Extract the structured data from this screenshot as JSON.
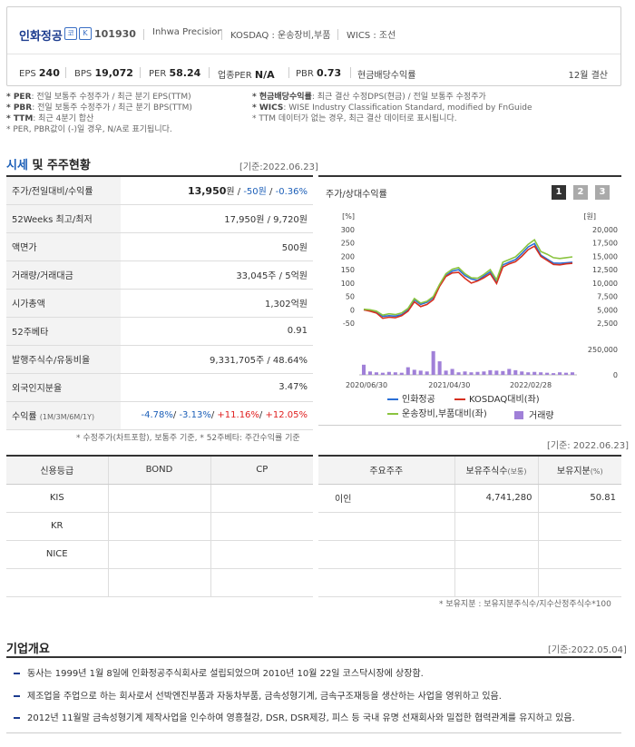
{
  "header": {
    "company_name": "인화정공",
    "icon_a": "코",
    "icon_b": "K",
    "code": "101930",
    "english_name": "Inhwa Precision",
    "market": "KOSDAQ : 운송장비,부품",
    "wics": "WICS : 조선",
    "eps_label": "EPS",
    "eps_value": "240",
    "bps_label": "BPS",
    "bps_value": "19,072",
    "per_label": "PER",
    "per_value": "58.24",
    "sector_per_label": "업종PER",
    "sector_per_value": "N/A",
    "pbr_label": "PBR",
    "pbr_value": "0.73",
    "div_label": "현금배당수익률",
    "fiscal": "12월 결산"
  },
  "notes": {
    "left": [
      {
        "key": "* PER",
        "text": ": 전일 보통주 수정주가 / 최근 분기 EPS(TTM)"
      },
      {
        "key": "* PBR",
        "text": ": 전일 보통주 수정주가 / 최근 분기 BPS(TTM)"
      },
      {
        "key": "* TTM",
        "text": ": 최근 4분기 합산"
      },
      {
        "key": "",
        "text": "* PER, PBR값이 (-)일 경우, N/A로 표기됩니다."
      }
    ],
    "right": [
      {
        "key": "* 현금배당수익률",
        "text": ": 최근 결산 수정DPS(현금) / 전일 보통주 수정주가"
      },
      {
        "key": "* WICS",
        "text": ": WISE Industry Classification Standard, modified by FnGuide"
      },
      {
        "key": "",
        "text": "* TTM 데이터가 없는 경우, 최근 결산 데이터로 표시됩니다."
      }
    ]
  },
  "market_section": {
    "title_a": "시세",
    "title_b": " 및 주주현황",
    "base_date": "[기준:2022.06.23]",
    "rows": [
      {
        "label": "주가/전일대비/수익률",
        "price": "13,950",
        "unit": "원",
        "change": "-50원",
        "rate": "-0.36%"
      },
      {
        "label": "52Weeks 최고/최저",
        "value": "17,950원 / 9,720원"
      },
      {
        "label": "액면가",
        "value": "500원"
      },
      {
        "label": "거래량/거래대금",
        "value": "33,045주 / 5억원"
      },
      {
        "label": "시가총액",
        "value": "1,302억원"
      },
      {
        "label": "52주베타",
        "value": "0.91"
      },
      {
        "label": "발행주식수/유동비율",
        "value": "9,331,705주 / 48.64%"
      },
      {
        "label": "외국인지분율",
        "value": "3.47%"
      },
      {
        "label": "수익률",
        "label_sub": "(1M/3M/6M/1Y)",
        "r1": "-4.78%",
        "r2": "-3.13%",
        "r3": "+11.16%",
        "r4": "+12.05%"
      }
    ],
    "footnote": "* 수정주가(차트포함), 보통주 기준, * 52주베타: 주간수익률 기준"
  },
  "chart_panel": {
    "title": "주가/상대수익률",
    "pages": [
      "1",
      "2",
      "3"
    ],
    "left_unit": "[%]",
    "right_unit": "[원]"
  },
  "chart_data": {
    "type": "line",
    "x_ticks": [
      "2020/06/30",
      "2021/04/30",
      "2022/02/28"
    ],
    "y_left_ticks": [
      "300",
      "250",
      "200",
      "150",
      "100",
      "50",
      "0",
      "-50"
    ],
    "ylim_left": [
      -50,
      300
    ],
    "y_right_ticks": [
      "20,000",
      "17,500",
      "15,000",
      "12,500",
      "10,000",
      "7,500",
      "5,000",
      "2,500"
    ],
    "ylim_right": [
      2500,
      20000
    ],
    "volume_tick": "250,000",
    "volume_zero": "0",
    "x_index": [
      0,
      1,
      2,
      3,
      4,
      5,
      6,
      7,
      8,
      9,
      10,
      11,
      12,
      13,
      14,
      15,
      16,
      17,
      18,
      19,
      20,
      21,
      22,
      23,
      24,
      25,
      26,
      27,
      28,
      29,
      30,
      31,
      32,
      33
    ],
    "series": [
      {
        "name": "인화정공",
        "color": "#2a6fd6",
        "values": [
          0,
          -2,
          -8,
          -25,
          -22,
          -24,
          -18,
          0,
          38,
          20,
          28,
          45,
          92,
          128,
          145,
          150,
          128,
          115,
          110,
          126,
          142,
          105,
          168,
          178,
          188,
          210,
          235,
          248,
          205,
          190,
          175,
          174,
          176,
          178
        ]
      },
      {
        "name": "KOSDAQ대비(좌)",
        "color": "#d6301f",
        "values": [
          0,
          -5,
          -12,
          -32,
          -28,
          -30,
          -22,
          -5,
          30,
          12,
          20,
          38,
          88,
          125,
          138,
          140,
          118,
          100,
          108,
          120,
          135,
          98,
          160,
          172,
          180,
          200,
          225,
          238,
          200,
          185,
          170,
          168,
          172,
          174
        ]
      },
      {
        "name": "운송장비,부품대비(좌)",
        "color": "#8ac43f",
        "values": [
          2,
          0,
          -5,
          -20,
          -15,
          -18,
          -12,
          5,
          42,
          25,
          32,
          50,
          95,
          135,
          152,
          158,
          135,
          120,
          118,
          132,
          150,
          112,
          178,
          188,
          198,
          220,
          245,
          262,
          218,
          208,
          195,
          192,
          195,
          198
        ]
      }
    ],
    "volume": {
      "name": "거래량",
      "color": "#a080d8",
      "values": [
        120,
        40,
        30,
        25,
        35,
        30,
        25,
        90,
        60,
        50,
        40,
        280,
        160,
        50,
        70,
        30,
        40,
        30,
        35,
        40,
        55,
        50,
        45,
        70,
        55,
        40,
        30,
        35,
        30,
        25,
        20,
        30,
        25,
        30
      ]
    }
  },
  "credit_section": {
    "headers": [
      "신용등급",
      "BOND",
      "CP"
    ],
    "rows": [
      [
        "KIS",
        "",
        ""
      ],
      [
        "KR",
        "",
        ""
      ],
      [
        "NICE",
        "",
        ""
      ],
      [
        "",
        "",
        ""
      ]
    ]
  },
  "holders_section": {
    "base_date": "[기준: 2022.06.23]",
    "headers": [
      "주요주주",
      "보유주식수",
      "(보통)",
      "보유지분",
      "(%)"
    ],
    "rows": [
      [
        "이인",
        "4,741,280",
        "50.81"
      ],
      [
        "",
        "",
        ""
      ],
      [
        "",
        "",
        ""
      ],
      [
        "",
        "",
        ""
      ]
    ],
    "footnote": "* 보유지분 : 보유지분주식수/지수산정주식수*100"
  },
  "company_section": {
    "title": "기업개요",
    "base_date": "[기준:2022.05.04]",
    "items": [
      "동사는 1999년 1월 8일에 인화정공주식회사로 설립되었으며 2010년 10월 22일 코스닥시장에 상장함.",
      "제조업을 주업으로 하는 회사로서 선박엔진부품과 자동차부품, 금속성형기계, 금속구조재등을 생산하는 사업을 영위하고 있음.",
      "2012년 11월말 금속성형기계 제작사업을 인수하여 영흥철강, DSR, DSR제강, 피스 등 국내 유명 선재회사와 밀접한 협력관계를 유지하고 있음."
    ]
  }
}
